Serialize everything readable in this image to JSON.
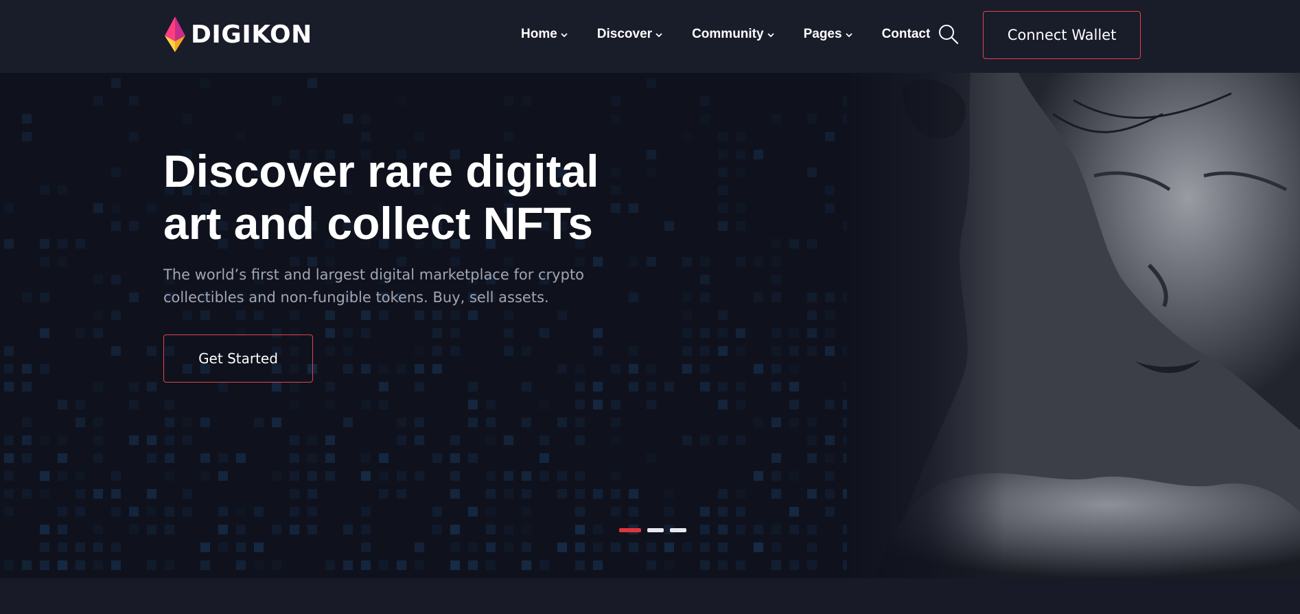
{
  "brand": {
    "name": "DIGIKON",
    "colors": {
      "accent": "#e0454d",
      "logo_pink": "#ff3d7f",
      "logo_yellow": "#ffc83d",
      "background": "#171a26"
    }
  },
  "nav": {
    "items": [
      {
        "label": "Home",
        "has_dropdown": true
      },
      {
        "label": "Discover",
        "has_dropdown": true
      },
      {
        "label": "Community",
        "has_dropdown": true
      },
      {
        "label": "Pages",
        "has_dropdown": true
      },
      {
        "label": "Contact",
        "has_dropdown": false
      }
    ],
    "search_icon": "search-icon",
    "connect_wallet_label": "Connect Wallet"
  },
  "hero": {
    "title_line1": "Discover rare digital",
    "title_line2": "art and collect NFTs",
    "subtitle_line1": "The world’s first and largest digital marketplace for crypto",
    "subtitle_line2": "collectibles and non-fungible tokens. Buy, sell assets.",
    "cta_label": "Get Started",
    "slider": {
      "total": 3,
      "active_index": 0
    }
  }
}
